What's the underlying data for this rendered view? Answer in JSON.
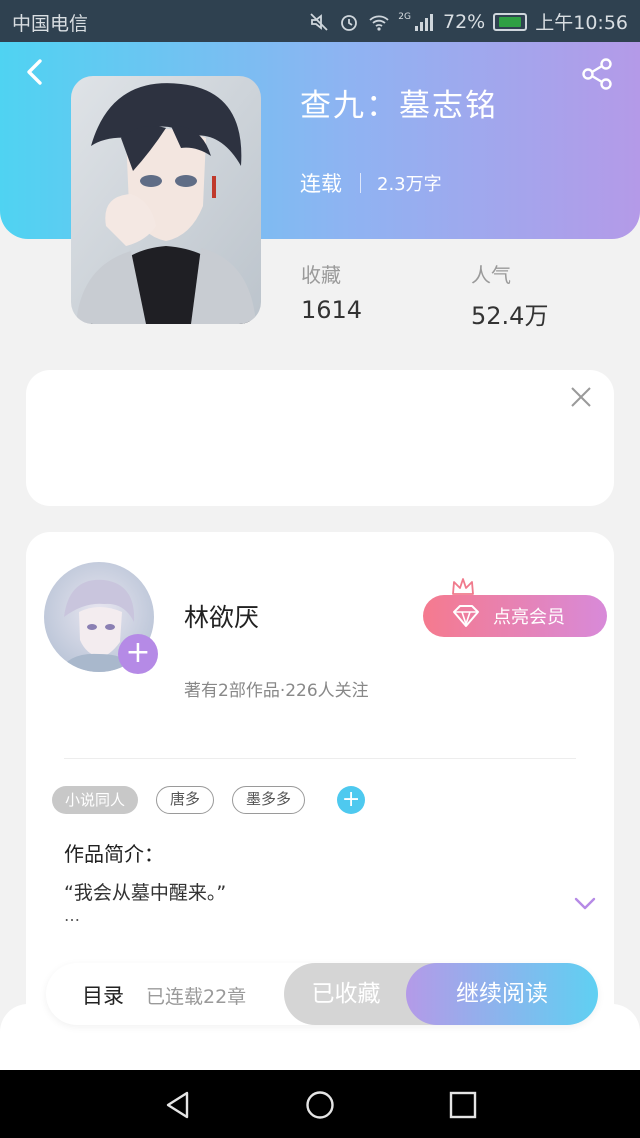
{
  "status_bar": {
    "carrier": "中国电信",
    "network": "2G",
    "battery": "72%",
    "time": "上午10:56"
  },
  "book": {
    "title": "查九：墓志铭",
    "status": "连载",
    "word_count": "2.3万字",
    "favorites_label": "收藏",
    "favorites_value": "1614",
    "popularity_label": "人气",
    "popularity_value": "52.4万"
  },
  "author": {
    "name": "林欲厌",
    "meta": "著有2部作品·226人关注",
    "vip_button": "点亮会员"
  },
  "tags": [
    "小说同人",
    "唐多",
    "墨多多"
  ],
  "intro": {
    "heading": "作品简介：",
    "text": "“我会从墓中醒来。”",
    "ellipsis": "…"
  },
  "action_bar": {
    "toc_label": "目录",
    "chapters": "已连载22章",
    "collected": "已收藏",
    "continue_reading": "继续阅读"
  },
  "colors": {
    "header_gradient": [
      "#4fd3f2",
      "#b49ae8"
    ],
    "vip_gradient": [
      "#f57a8e",
      "#d88ad9"
    ],
    "accent_purple": "#b58ae6",
    "accent_cyan": "#4ec9ef"
  },
  "icons": [
    "back-arrow-icon",
    "share-icon",
    "close-icon",
    "plus-icon",
    "crown-icon",
    "diamond-icon",
    "chevron-down-icon",
    "nav-back-icon",
    "nav-home-icon",
    "nav-recent-icon"
  ]
}
